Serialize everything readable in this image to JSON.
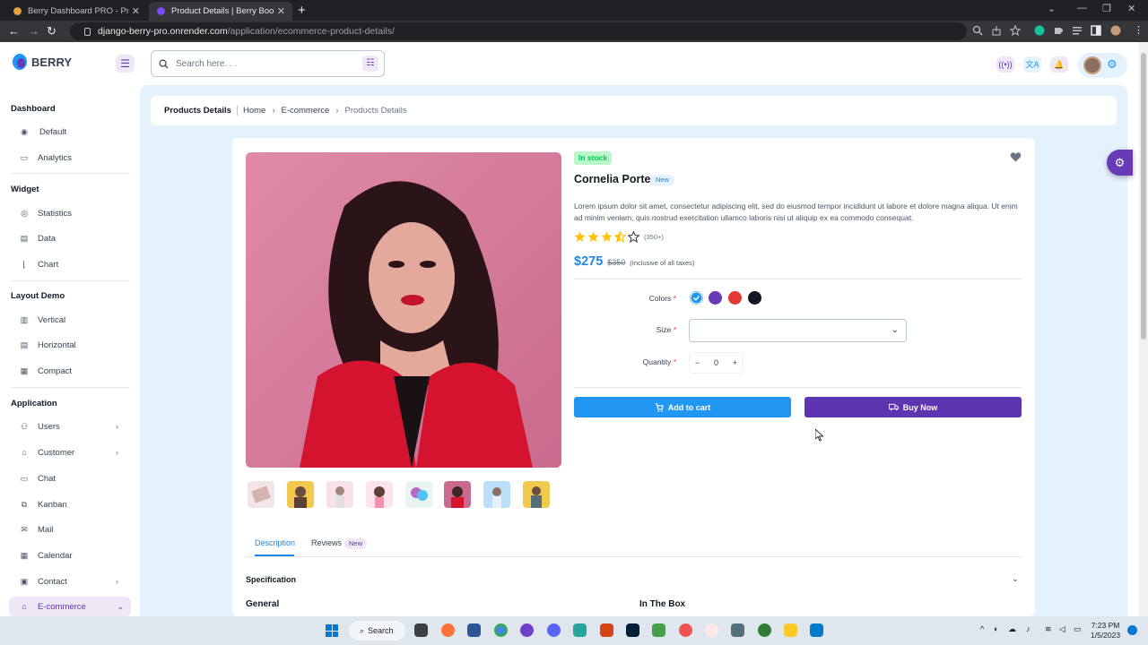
{
  "browser": {
    "tabs": [
      {
        "title": "Berry Dashboard PRO - Premium"
      },
      {
        "title": "Product Details | Berry Bootstrap"
      }
    ],
    "new_tab": "+",
    "url_host": "django-berry-pro.onrender.com",
    "url_path": "/application/ecommerce-product-details/"
  },
  "header": {
    "logo_text": "BERRY",
    "search_placeholder": "Search here. . ."
  },
  "sidebar": {
    "sections": [
      {
        "title": "Dashboard",
        "items": [
          "Default",
          "Analytics"
        ]
      },
      {
        "title": "Widget",
        "items": [
          "Statistics",
          "Data",
          "Chart"
        ]
      },
      {
        "title": "Layout Demo",
        "items": [
          "Vertical",
          "Horizontal",
          "Compact"
        ]
      },
      {
        "title": "Application",
        "items": [
          "Users",
          "Customer",
          "Chat",
          "Kanban",
          "Mail",
          "Calendar",
          "Contact",
          "E-commerce"
        ]
      }
    ]
  },
  "breadcrumb": {
    "title": "Products Details",
    "home": "Home",
    "section": "E-commerce",
    "current": "Products Details"
  },
  "product": {
    "stock": "In stock",
    "name": "Cornelia Porter",
    "tag": "New",
    "description": "Lorem ipsum dolor sit amet, consectetur adipiscing elit, sed do eiusmod tempor incididunt ut labore et dolore magna aliqua. Ut enim ad minim veniam, quis nostrud exercitation ullamco laboris nisi ut aliquip ex ea commodo consequat.",
    "rating": 3.5,
    "rating_count": "(350+)",
    "price": "$275",
    "old_price": "$350",
    "tax_note": "(Inclusive of all taxes)",
    "colors_label": "Colors",
    "colors": [
      "#2196f3",
      "#673ab7",
      "#e53935",
      "#121926"
    ],
    "size_label": "Size",
    "size_value": "",
    "quantity_label": "Quantity",
    "quantity": "0",
    "required_mark": "*",
    "add_to_cart": "Add to cart",
    "buy_now": "Buy Now"
  },
  "details_tabs": {
    "description": "Description",
    "reviews": "Reviews",
    "reviews_chip": "New"
  },
  "spec": {
    "title": "Specification",
    "general": "General",
    "in_the_box": "In The Box"
  },
  "taskbar": {
    "search": "Search",
    "time": "7:23 PM",
    "date": "1/5/2023"
  }
}
